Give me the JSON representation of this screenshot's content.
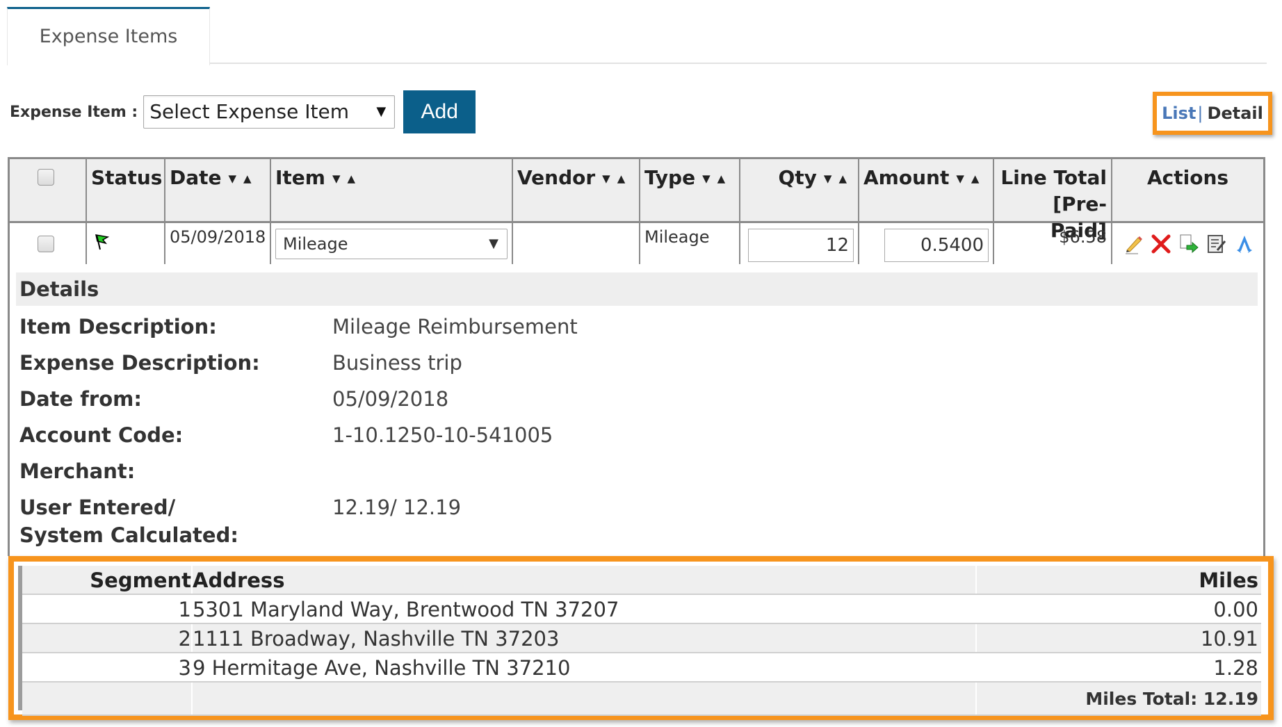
{
  "tabs": [
    {
      "label": "Expense Items",
      "active": true
    }
  ],
  "toolbar": {
    "label": "Expense Item :",
    "select_value": "Select Expense Item",
    "add_label": "Add"
  },
  "view_toggle": {
    "list": "List",
    "separator": "|",
    "detail": "Detail",
    "highlight_color": "#f7941d"
  },
  "grid": {
    "headers": {
      "status": "Status",
      "date": "Date",
      "item": "Item",
      "vendor": "Vendor",
      "type": "Type",
      "qty": "Qty",
      "amount": "Amount",
      "line_total_1": "Line Total",
      "line_total_2": "[Pre-Paid]",
      "actions": "Actions"
    },
    "sort_glyph": "▼▲",
    "row": {
      "status_icon": "green-flag-icon",
      "date": "05/09/2018",
      "item": "Mileage",
      "vendor": "",
      "type": "Mileage",
      "qty": "12",
      "amount": "0.5400",
      "line_total": "$6.58",
      "actions": [
        "edit-pencil-icon",
        "delete-x-icon",
        "copy-move-icon",
        "notes-icon",
        "route-icon"
      ]
    }
  },
  "details": {
    "title": "Details",
    "fields": [
      {
        "label": "Item Description:",
        "value": "Mileage Reimbursement"
      },
      {
        "label": "Expense Description:",
        "value": "Business trip"
      },
      {
        "label": "Date from:",
        "value": "05/09/2018"
      },
      {
        "label": "Account Code:",
        "value": "1-10.1250-10-541005"
      },
      {
        "label": "Merchant:",
        "value": ""
      },
      {
        "label": "User Entered/",
        "label2": "System Calculated:",
        "value": "12.19/ 12.19"
      }
    ]
  },
  "segments": {
    "headers": {
      "segment": "Segment",
      "address": "Address",
      "miles": "Miles"
    },
    "rows": [
      {
        "segment": "1",
        "address": "5301 Maryland Way, Brentwood TN 37207",
        "miles": "0.00"
      },
      {
        "segment": "2",
        "address": "1111 Broadway, Nashville TN 37203",
        "miles": "10.91"
      },
      {
        "segment": "3",
        "address": "9 Hermitage Ave, Nashville TN 37210",
        "miles": "1.28"
      }
    ],
    "total": "Miles Total: 12.19"
  }
}
